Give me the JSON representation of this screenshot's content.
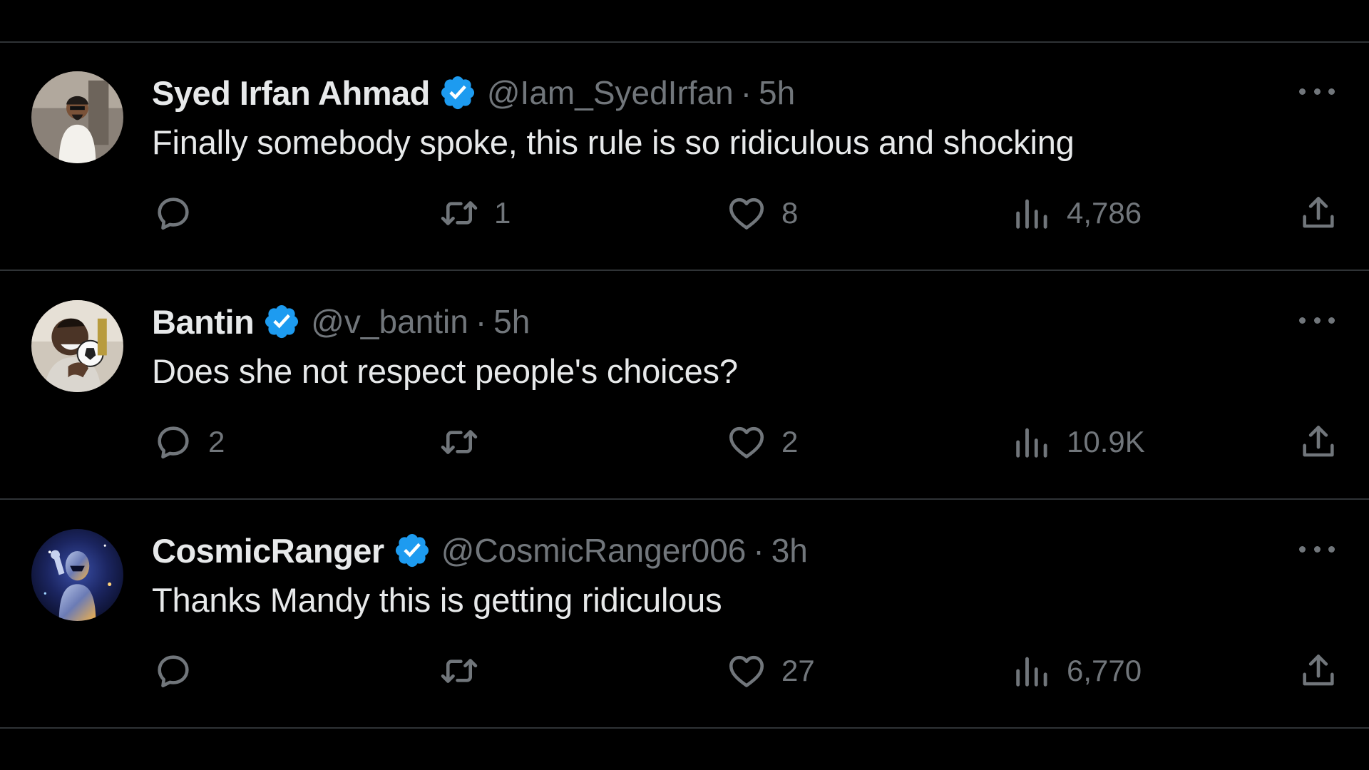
{
  "tweets": [
    {
      "name": "Syed Irfan Ahmad",
      "handle": "@Iam_SyedIrfan",
      "separator": "·",
      "time": "5h",
      "text": "Finally somebody spoke, this rule is so ridiculous and shocking",
      "replies": "",
      "retweets": "1",
      "likes": "8",
      "views": "4,786"
    },
    {
      "name": "Bantin",
      "handle": "@v_bantin",
      "separator": "·",
      "time": "5h",
      "text": "Does she not respect people's choices?",
      "replies": "2",
      "retweets": "",
      "likes": "2",
      "views": "10.9K"
    },
    {
      "name": "CosmicRanger",
      "handle": "@CosmicRanger006",
      "separator": "·",
      "time": "3h",
      "text": "Thanks Mandy this is getting ridiculous",
      "replies": "",
      "retweets": "",
      "likes": "27",
      "views": "6,770"
    }
  ],
  "icons": {
    "verified": "verified-badge-icon",
    "more": "more-options-icon",
    "reply": "reply-icon",
    "retweet": "retweet-icon",
    "like": "like-heart-icon",
    "views": "views-chart-icon",
    "share": "share-icon"
  },
  "colors": {
    "background": "#000000",
    "text": "#e7e9ea",
    "secondary": "#71767b",
    "divider": "#2f3336",
    "verified": "#1d9bf0"
  }
}
